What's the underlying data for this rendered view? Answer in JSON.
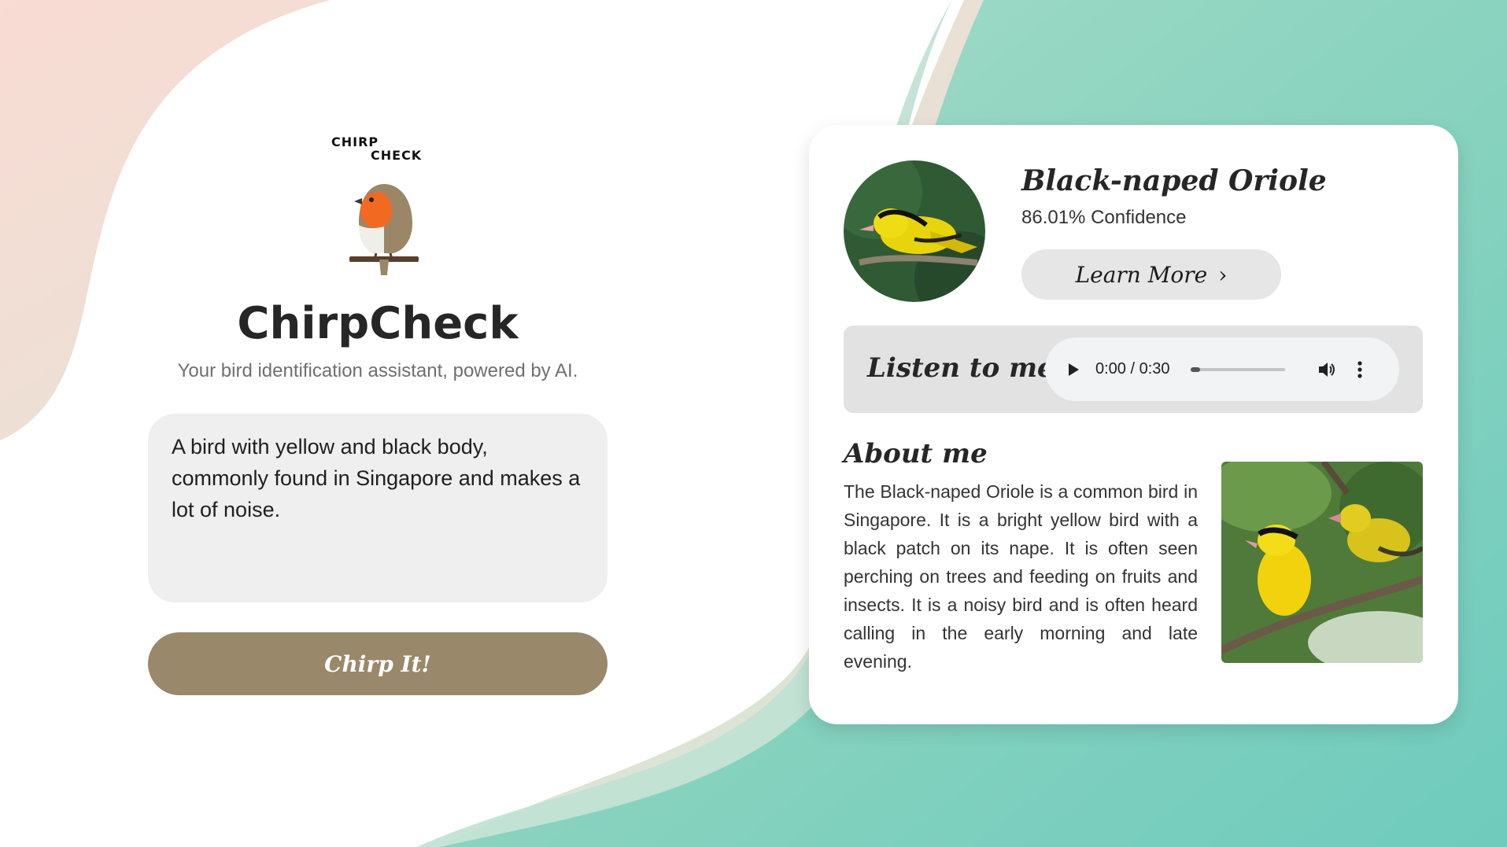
{
  "app": {
    "logo_line1": "CHIRP",
    "logo_line2": "CHECK",
    "title": "ChirpCheck",
    "subtitle": "Your bird identification assistant, powered by AI.",
    "prompt_text": "A bird with yellow and black body, commonly found in Singapore and makes a lot of noise.",
    "chirp_button": "Chirp It!"
  },
  "result": {
    "bird_name": "Black-naped Oriole",
    "confidence": "86.01% Confidence",
    "learn_more": "Learn More",
    "listen_label": "Listen to me",
    "audio": {
      "time": "0:00 / 0:30",
      "progress": 0
    },
    "about_title": "About me",
    "about_text": "The Black-naped Oriole is a common bird in Singapore. It is a bright yellow bird with a black patch on its nape. It is often seen perching on trees and feeding on fruits and insects. It is a noisy bird and is often heard calling in the early morning and late evening."
  },
  "colors": {
    "chirp_button": "#9a886b",
    "card_bg": "#ffffff",
    "bg_green": "#7fd0bf",
    "bg_peach": "#f8ddd3"
  },
  "icons": {
    "play": "play-icon",
    "volume": "volume-icon",
    "more": "more-vertical-icon",
    "chevron": "chevron-right-icon"
  }
}
